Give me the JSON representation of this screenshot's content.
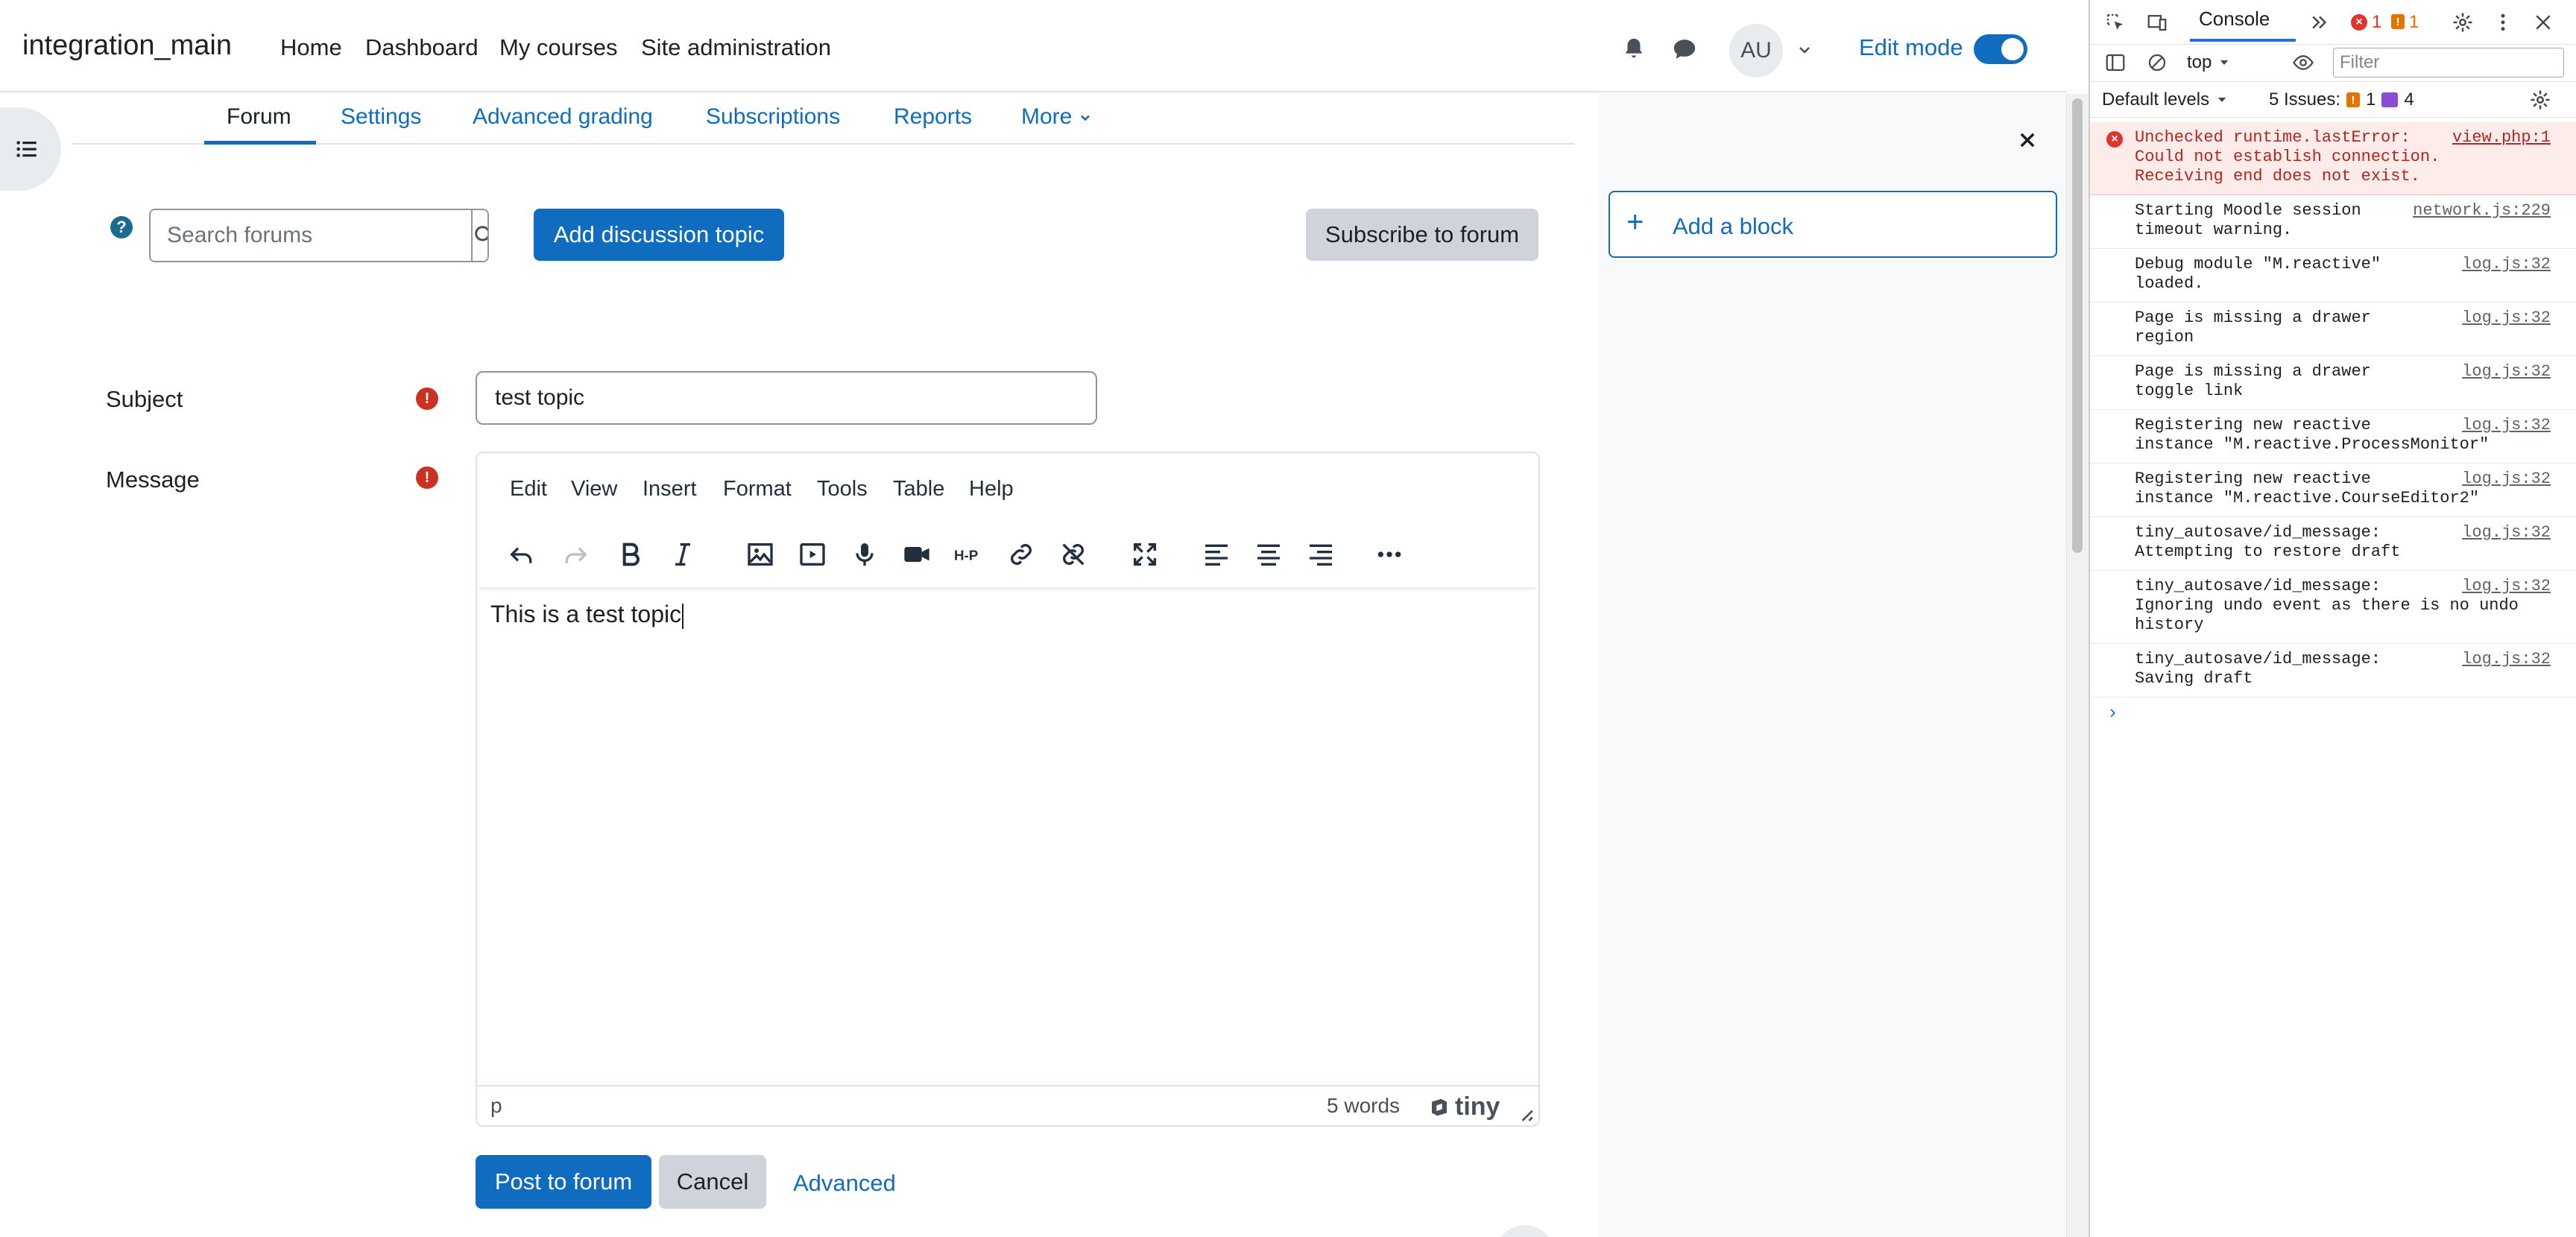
{
  "navbar": {
    "brand": "integration_main",
    "links": [
      "Home",
      "Dashboard",
      "My courses",
      "Site administration"
    ],
    "avatar_initials": "AU",
    "edit_mode_label": "Edit mode",
    "edit_mode_on": true
  },
  "secondary_nav": {
    "tabs": [
      "Forum",
      "Settings",
      "Advanced grading",
      "Subscriptions",
      "Reports",
      "More"
    ],
    "active": "Forum"
  },
  "forum_actions": {
    "search_placeholder": "Search forums",
    "add_discussion_label": "Add discussion topic",
    "subscribe_label": "Subscribe to forum"
  },
  "form": {
    "subject_label": "Subject",
    "subject_value": "test topic",
    "message_label": "Message",
    "post_label": "Post to forum",
    "cancel_label": "Cancel",
    "advanced_label": "Advanced"
  },
  "editor": {
    "menus": [
      "Edit",
      "View",
      "Insert",
      "Format",
      "Tools",
      "Table",
      "Help"
    ],
    "content": "This is a test topic",
    "path": "p",
    "word_count": "5 words",
    "brand": "tiny"
  },
  "block_drawer": {
    "add_block_label": "Add a block"
  },
  "devtools": {
    "active_tab": "Console",
    "error_count": "1",
    "warning_count": "1",
    "context": "top",
    "filter_placeholder": "Filter",
    "levels_label": "Default levels",
    "issues_label": "5 Issues:",
    "issues_warn": "1",
    "issues_info": "4",
    "logs": [
      {
        "type": "error",
        "lines": [
          "Unchecked runtime.lastError:",
          "Could not establish connection.",
          "Receiving end does not exist."
        ],
        "source": "view.php:1"
      },
      {
        "type": "info",
        "lines": [
          "Starting Moodle session",
          "timeout warning."
        ],
        "source": "network.js:229"
      },
      {
        "type": "info",
        "lines": [
          "Debug module \"M.reactive\"",
          "loaded."
        ],
        "source": "log.js:32"
      },
      {
        "type": "info",
        "lines": [
          "Page is missing a drawer",
          "region"
        ],
        "source": "log.js:32"
      },
      {
        "type": "info",
        "lines": [
          "Page is missing a drawer",
          "toggle link"
        ],
        "source": "log.js:32"
      },
      {
        "type": "info",
        "lines": [
          "Registering new reactive",
          "instance \"M.reactive.ProcessMonitor\""
        ],
        "source": "log.js:32"
      },
      {
        "type": "info",
        "lines": [
          "Registering new reactive",
          "instance \"M.reactive.CourseEditor2\""
        ],
        "source": "log.js:32"
      },
      {
        "type": "info",
        "lines": [
          "tiny_autosave/id_message:",
          "Attempting to restore draft"
        ],
        "source": "log.js:32"
      },
      {
        "type": "info",
        "lines": [
          "tiny_autosave/id_message:",
          "Ignoring undo event as there is no undo",
          "history"
        ],
        "source": "log.js:32"
      },
      {
        "type": "info",
        "lines": [
          "tiny_autosave/id_message:",
          "Saving draft"
        ],
        "source": "log.js:32"
      }
    ]
  },
  "colors": {
    "primary": "#0f6cbf",
    "danger": "#ca3120",
    "secondary": "#ced4da"
  }
}
